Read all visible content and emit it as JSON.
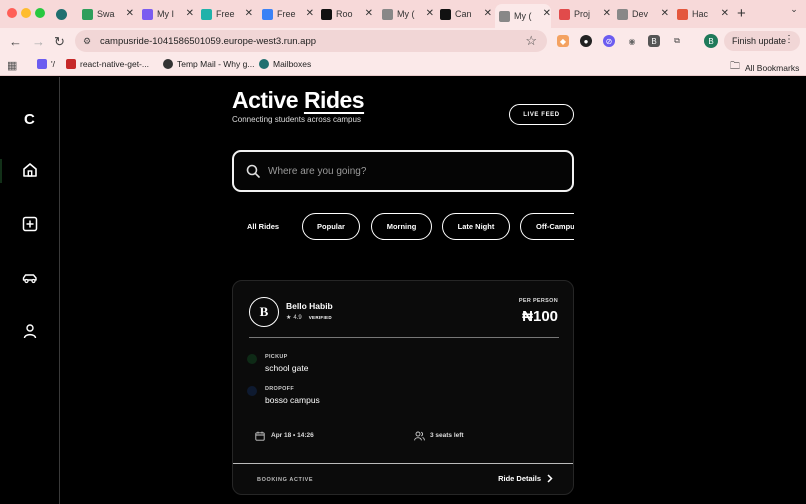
{
  "browser": {
    "traffic_colors": [
      "#ff5f57",
      "#febc2e",
      "#28c840"
    ],
    "tabs": [
      {
        "label": "Swa",
        "icon": "green-circle-icon",
        "color": "#2e9e5b"
      },
      {
        "label": "My I",
        "icon": "purple-shield-icon",
        "color": "#7b5cf0"
      },
      {
        "label": "Free",
        "icon": "teal-pen-icon",
        "color": "#20b2aa"
      },
      {
        "label": "Free",
        "icon": "blue-search-icon",
        "color": "#3b82f6"
      },
      {
        "label": "Roo",
        "icon": "black-square-icon",
        "color": "#111111"
      },
      {
        "label": "My (",
        "icon": "globe-icon",
        "color": "#888888"
      },
      {
        "label": "Can",
        "icon": "black-square-icon",
        "color": "#111111"
      },
      {
        "label": "My (",
        "icon": "globe-icon",
        "color": "#888888"
      },
      {
        "label": "Proj",
        "icon": "red-ring-icon",
        "color": "#e14b4b"
      },
      {
        "label": "Dev",
        "icon": "flask-icon",
        "color": "#888888"
      },
      {
        "label": "Hac",
        "icon": "red-blob-icon",
        "color": "#e4573d"
      }
    ],
    "active_tab_index": 7,
    "url": "campusride-1041586501059.europe-west3.run.app",
    "finish_update_label": "Finish update",
    "profile_initial": "B",
    "bookmarks": [
      {
        "label": "'/",
        "color": "#6b5cf0"
      },
      {
        "label": "react-native-get-...",
        "color": "#c62828"
      },
      {
        "label": "Temp Mail - Why g...",
        "color": "#333333"
      },
      {
        "label": "Mailboxes",
        "color": "#1f6f6f"
      }
    ],
    "all_bookmarks_label": "All Bookmarks"
  },
  "sidebar": {
    "logo": "C",
    "items": [
      {
        "name": "home",
        "icon": "home-icon"
      },
      {
        "name": "add",
        "icon": "plus-square-icon"
      },
      {
        "name": "rides",
        "icon": "car-icon"
      },
      {
        "name": "profile",
        "icon": "user-icon"
      }
    ]
  },
  "header": {
    "title_plain": "Active",
    "title_underlined": "Rides",
    "subtitle": "Connecting students across campus",
    "live_feed_label": "LIVE FEED"
  },
  "search": {
    "placeholder": "Where are you going?",
    "icon": "search-icon"
  },
  "filters": [
    "All Rides",
    "Popular",
    "Morning",
    "Late Night",
    "Off-Campus"
  ],
  "ride": {
    "avatar_initial": "B",
    "driver_name": "Bello Habib",
    "rating_star": "★",
    "rating": "4.9",
    "verified_label": "VERIFIED",
    "price_label": "PER PERSON",
    "price": "₦100",
    "pickup_label": "PICKUP",
    "pickup": "school gate",
    "dropoff_label": "DROPOFF",
    "dropoff": "bosso campus",
    "datetime": "Apr 18 • 14:26",
    "seats": "3 seats left",
    "status": "BOOKING ACTIVE",
    "details_label": "Ride Details"
  },
  "colors": {
    "background": "#000000",
    "card": "#0b0b0b",
    "pickup_dot": "#0e2a16",
    "dropoff_dot": "#0e1a30",
    "tab_bar": "#f7d9d9"
  }
}
